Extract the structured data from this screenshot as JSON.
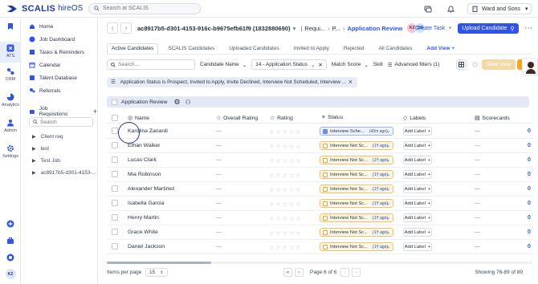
{
  "app": {
    "brand": "SCALIS",
    "product": "hireOS",
    "search_placeholder": "Search at SCALIS",
    "org": "Ward and Sons"
  },
  "rail": [
    {
      "label": "",
      "icon": "bookmark-icon"
    },
    {
      "label": "ATS",
      "icon": "ats-icon"
    },
    {
      "label": "CRM",
      "icon": "crm-icon"
    },
    {
      "label": "Analytics",
      "icon": "analytics-icon"
    },
    {
      "label": "Admin",
      "icon": "admin-icon"
    },
    {
      "label": "Settings",
      "icon": "settings-icon"
    },
    {
      "label": "",
      "icon": "plus-icon"
    },
    {
      "label": "",
      "icon": "briefcase-icon"
    },
    {
      "label": "",
      "icon": "chat-icon"
    },
    {
      "label": "KZ",
      "icon": "avatar"
    }
  ],
  "nav": {
    "items": [
      "Home",
      "Job Dashboard",
      "Tasks & Reminders",
      "Calendar",
      "Talent Database",
      "Referrals"
    ],
    "section": "Job Requisitions",
    "search_placeholder": "Search",
    "tree": [
      "Client req",
      "test",
      "Test Job",
      "ac8917b5-d301-4153-..."
    ]
  },
  "header": {
    "title": "ac8917b5-d301-4153-916c-b9675efb61f9 (1832880690)",
    "crumb1": "Requi...",
    "crumb2": "P...",
    "current": "Application Review",
    "avatars": [
      "KZ",
      "DB"
    ],
    "create_task": "Create Task",
    "upload": "Upload Candidate"
  },
  "tabs": [
    "Active Candidates",
    "SCALIS Candidates",
    "Uploaded Candidates",
    "Invited to Apply",
    "Rejected",
    "All Candidates",
    "Add View"
  ],
  "filters": {
    "search_placeholder": "Search...",
    "candidate_name": "Candidate Name",
    "app_status": "14 - Application Status",
    "match_score": "Match Score",
    "skills": "Skill",
    "advanced": "Advanced filters (1)",
    "save_view": "Save View"
  },
  "banner": "Application Status is Prospect, Invited to Apply, Invite Declined, Interview Not Scheduled, Interview ...",
  "review_label": "Application Review",
  "columns": [
    "Name",
    "Overall Rating",
    "Rating",
    "Status",
    "Labels",
    "Scorecards"
  ],
  "rows": [
    {
      "name": "Karolina Zanardi",
      "rating": "—",
      "status": "Interview Sche...",
      "age": "(43m ago)",
      "label": "Add Label",
      "score": "—",
      "n": "0"
    },
    {
      "name": "Ethan Walker",
      "rating": "—",
      "status": "Interview Not Sc...",
      "age": "(1Y ago)",
      "label": "Add Label",
      "score": "—",
      "n": "0"
    },
    {
      "name": "Lucas Clark",
      "rating": "—",
      "status": "Interview Not Sc...",
      "age": "(1Y ago)",
      "label": "Add Label",
      "score": "—",
      "n": "0"
    },
    {
      "name": "Mia Robinson",
      "rating": "—",
      "status": "Interview Not Sc...",
      "age": "(1Y ago)",
      "label": "Add Label",
      "score": "—",
      "n": "0"
    },
    {
      "name": "Alexander Martinez",
      "rating": "—",
      "status": "Interview Not Sc...",
      "age": "(1Y ago)",
      "label": "Add Label",
      "score": "—",
      "n": "0"
    },
    {
      "name": "Isabella Garcia",
      "rating": "—",
      "status": "Interview Not Sc...",
      "age": "(1Y ago)",
      "label": "Add Label",
      "score": "—",
      "n": "0"
    },
    {
      "name": "Henry Martin",
      "rating": "—",
      "status": "Interview Not Sc...",
      "age": "(1Y ago)",
      "label": "Add Label",
      "score": "—",
      "n": "0"
    },
    {
      "name": "Grace White",
      "rating": "—",
      "status": "Interview Not Sc...",
      "age": "(1Y ago)",
      "label": "Add Label",
      "score": "—",
      "n": "0"
    },
    {
      "name": "Daniel Jackson",
      "rating": "—",
      "status": "Interview Not Sc...",
      "age": "(1Y ago)",
      "label": "Add Label",
      "score": "—",
      "n": "0"
    }
  ],
  "footer": {
    "items_per_page": "Items per page",
    "per_page_value": "15",
    "page": "Page 6 of 6",
    "showing": "Showing 76-89 of 89"
  }
}
